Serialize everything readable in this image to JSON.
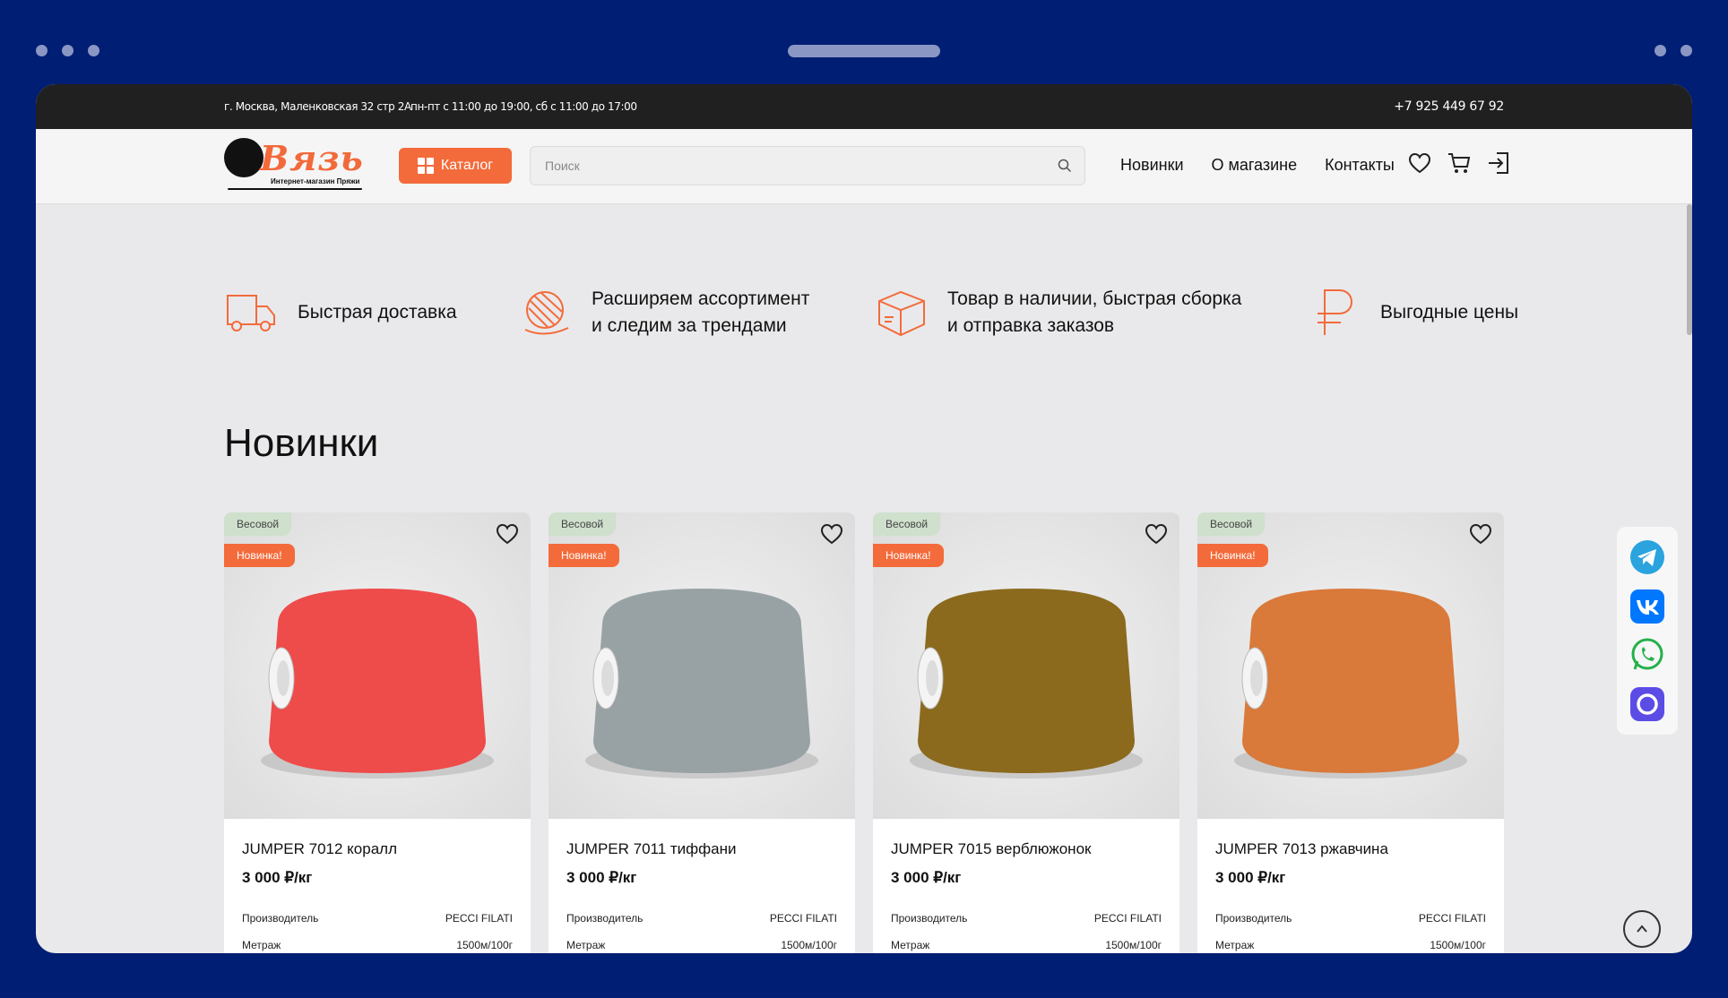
{
  "topbar": {
    "address": "г. Москва, Маленковская 32 стр 2А",
    "hours": "пн-пт с 11:00 до 19:00, сб с 11:00 до 17:00",
    "phone": "+7 925 449 67 92"
  },
  "header": {
    "logo_text": "Вязь",
    "logo_subtitle": "Интернет-магазин Пряжи",
    "catalog_label": "Каталог",
    "search_placeholder": "Поиск",
    "nav": [
      "Новинки",
      "О магазине",
      "Контакты"
    ],
    "icons": [
      "heart-icon",
      "cart-icon",
      "login-icon"
    ]
  },
  "features": [
    {
      "icon": "truck-icon",
      "line1": "Быстрая доставка",
      "line2": ""
    },
    {
      "icon": "yarn-ball-icon",
      "line1": "Расширяем ассортимент",
      "line2": "и следим за трендами"
    },
    {
      "icon": "box-icon",
      "line1": "Товар в наличии, быстрая сборка",
      "line2": "и отправка заказов"
    },
    {
      "icon": "ruble-icon",
      "line1": "Выгодные цены",
      "line2": ""
    }
  ],
  "section_title": "Новинки",
  "products": [
    {
      "badge_weight": "Весовой",
      "badge_new": "Новинка!",
      "name": "JUMPER 7012 коралл",
      "price": "3 000 ₽/кг",
      "maker_label": "Производитель",
      "maker": "PECCI FILATI",
      "length_label": "Метраж",
      "length": "1500м/100г",
      "color": "#ee4b4b"
    },
    {
      "badge_weight": "Весовой",
      "badge_new": "Новинка!",
      "name": "JUMPER 7011 тиффани",
      "price": "3 000 ₽/кг",
      "maker_label": "Производитель",
      "maker": "PECCI FILATI",
      "length_label": "Метраж",
      "length": "1500м/100г",
      "color": "#98a2a5"
    },
    {
      "badge_weight": "Весовой",
      "badge_new": "Новинка!",
      "name": "JUMPER 7015 верблюжонок",
      "price": "3 000 ₽/кг",
      "maker_label": "Производитель",
      "maker": "PECCI FILATI",
      "length_label": "Метраж",
      "length": "1500м/100г",
      "color": "#8b6a1e"
    },
    {
      "badge_weight": "Весовой",
      "badge_new": "Новинка!",
      "name": "JUMPER 7013 ржавчина",
      "price": "3 000 ₽/кг",
      "maker_label": "Производитель",
      "maker": "PECCI FILATI",
      "length_label": "Метраж",
      "length": "1500м/100г",
      "color": "#d9793a"
    }
  ],
  "social": [
    "telegram-icon",
    "vk-icon",
    "whatsapp-icon",
    "max-messenger-icon"
  ],
  "colors": {
    "accent": "#f36b3b",
    "frame": "#001e73",
    "topbar": "#202020"
  }
}
